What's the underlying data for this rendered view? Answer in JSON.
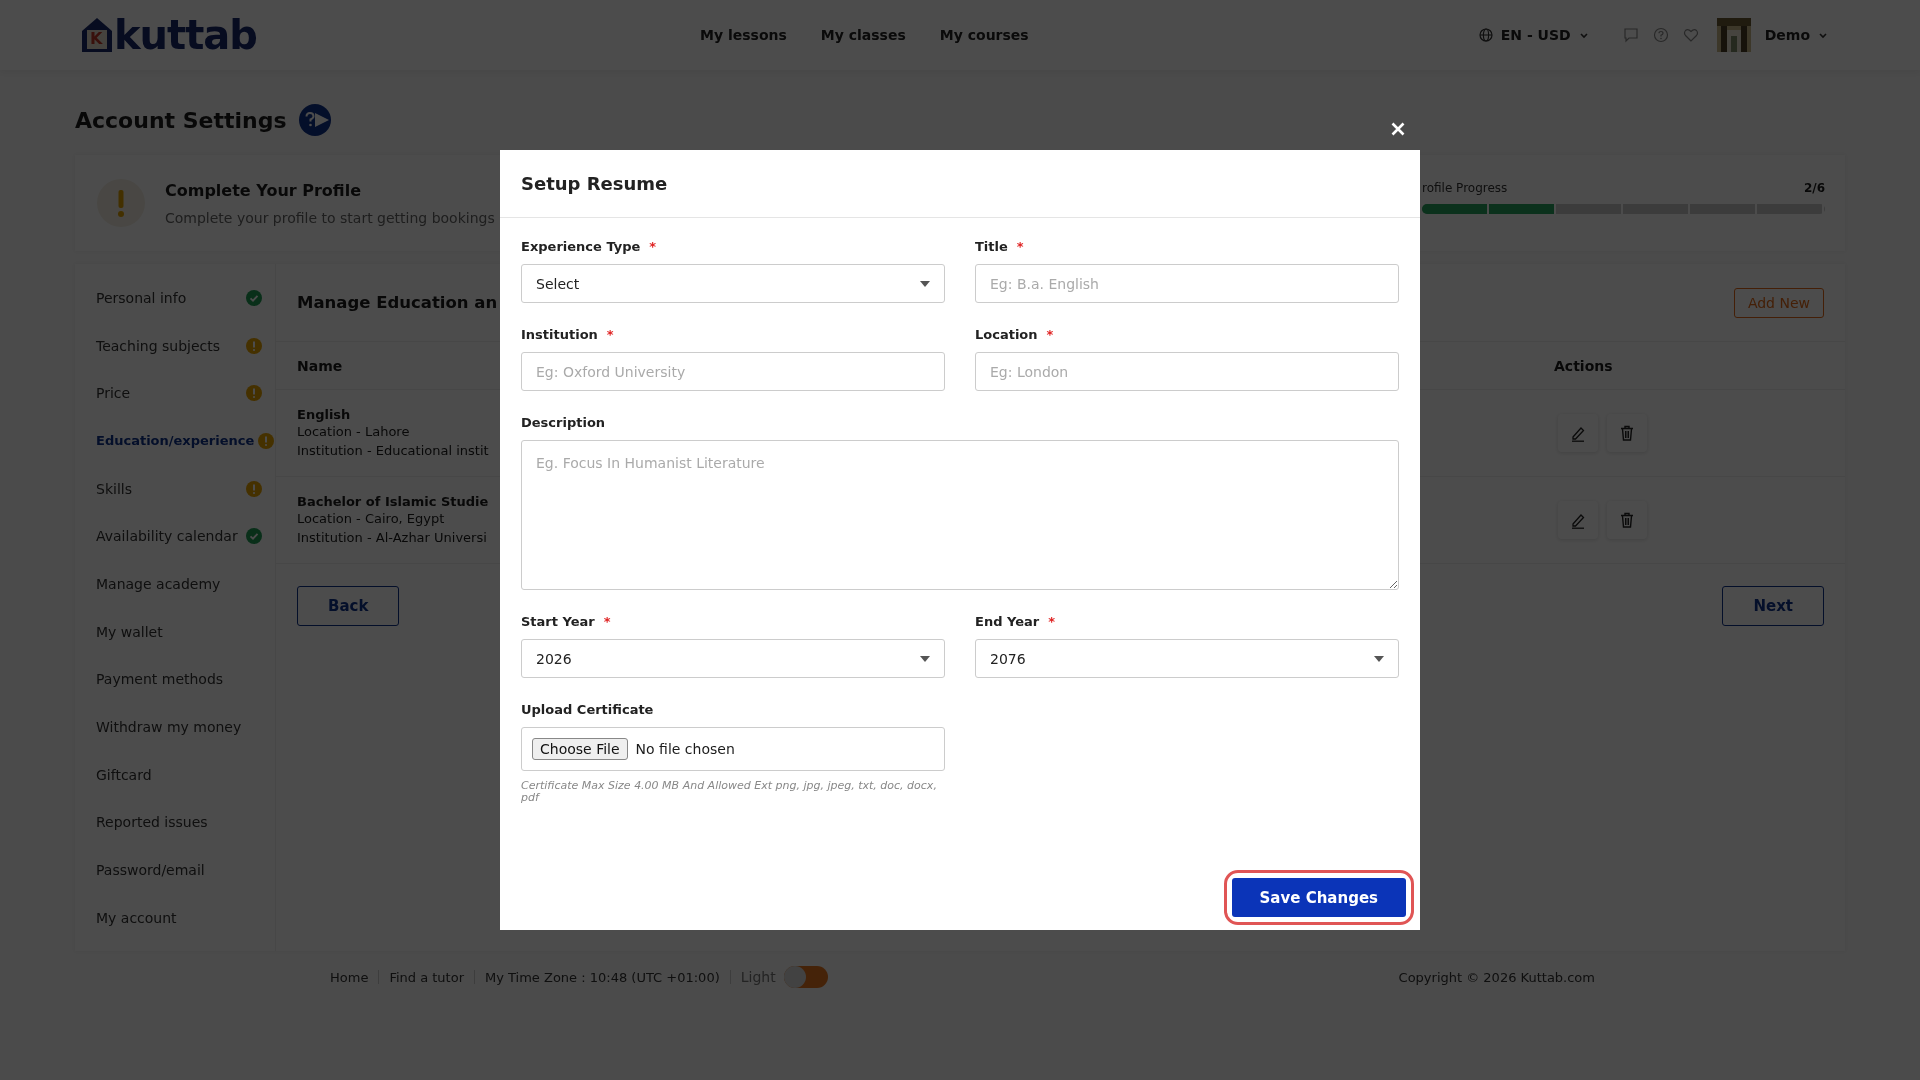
{
  "header": {
    "logo": {
      "letter": "K",
      "text": "kuttab"
    },
    "nav": [
      {
        "label": "My lessons"
      },
      {
        "label": "My classes"
      },
      {
        "label": "My courses"
      }
    ],
    "language": "EN - USD",
    "user": {
      "name": "Demo"
    }
  },
  "page_title": "Account Settings",
  "profile_banner": {
    "title": "Complete Your Profile",
    "text": "Complete your profile to start getting bookings",
    "progress_label": "rofile Progress",
    "progress_count": "2/6",
    "level": 0.3333
  },
  "sidebar": {
    "items": [
      {
        "label": "Personal info",
        "kind": "done",
        "selected": false
      },
      {
        "label": "Teaching subjects",
        "kind": "warning",
        "selected": false
      },
      {
        "label": "Price",
        "kind": "warning",
        "selected": false
      },
      {
        "label": "Education/experience",
        "kind": "warning",
        "selected": true
      },
      {
        "label": "Skills",
        "kind": "warning",
        "selected": false
      },
      {
        "label": "Availability calendar",
        "kind": "done",
        "selected": false
      },
      {
        "label": "Manage academy",
        "kind": "plain",
        "selected": false
      },
      {
        "label": "My wallet",
        "kind": "plain",
        "selected": false
      },
      {
        "label": "Payment methods",
        "kind": "plain",
        "selected": false
      },
      {
        "label": "Withdraw my money",
        "kind": "plain",
        "selected": false
      },
      {
        "label": "Giftcard",
        "kind": "plain",
        "selected": false
      },
      {
        "label": "Reported issues",
        "kind": "plain",
        "selected": false
      },
      {
        "label": "Password/email",
        "kind": "plain",
        "selected": false
      },
      {
        "label": "My account",
        "kind": "plain",
        "selected": false
      }
    ]
  },
  "section": {
    "title": "Manage Education an",
    "add_button": "Add New",
    "columns": [
      "Name",
      "Actions"
    ],
    "rows": [
      {
        "name": "English",
        "location": "Location - Lahore",
        "institution": "Institution - Educational instit"
      },
      {
        "name": "Bachelor of Islamic Studie",
        "location": "Location - Cairo, Egypt",
        "institution": "Institution - Al-Azhar Universi"
      }
    ],
    "back_button": "Back",
    "next_button": "Next"
  },
  "footer": {
    "links": [
      "Home",
      "Find a tutor"
    ],
    "timezone": "My Time Zone : 10:48 (UTC +01:00)",
    "theme_label": "Light",
    "theme_toggle_on": false,
    "copyright": "Copyright © 2026 Kuttab.com"
  },
  "modal": {
    "title": "Setup Resume",
    "fields": [
      {
        "kind": "select",
        "label": "Experience Type",
        "required_mark": "*",
        "value": "Select"
      },
      {
        "kind": "input",
        "label": "Title",
        "required_mark": "*",
        "placeholder": "Eg: B.a. English"
      },
      {
        "kind": "input",
        "label": "Institution",
        "required_mark": "*",
        "placeholder": "Eg: Oxford University"
      },
      {
        "kind": "input",
        "label": "Location",
        "required_mark": "*",
        "placeholder": "Eg: London"
      },
      {
        "kind": "textarea",
        "label": "Description",
        "placeholder": "Eg. Focus In Humanist Literature"
      },
      {
        "kind": "select",
        "label": "Start Year",
        "required_mark": "*",
        "value": "2026"
      },
      {
        "kind": "select",
        "label": "End Year",
        "required_mark": "*",
        "value": "2076"
      },
      {
        "kind": "file",
        "label": "Upload Certificate",
        "button": "Choose File",
        "status": "No file chosen",
        "hint": "Certificate Max Size 4.00 MB And Allowed Ext png, jpg, jpeg, txt, doc, docx, pdf"
      }
    ],
    "save_button": {
      "label": "Save Changes",
      "focused": true
    }
  }
}
